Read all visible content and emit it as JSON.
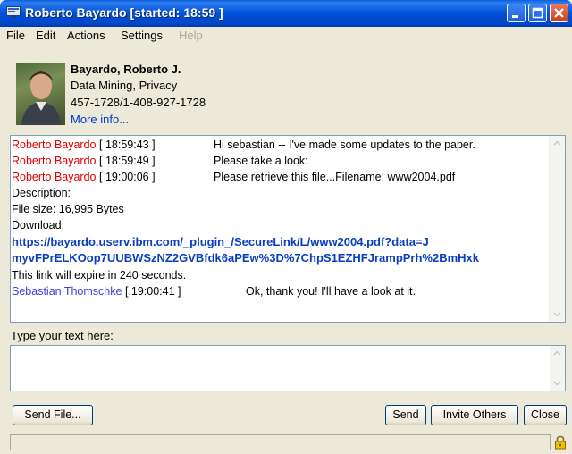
{
  "window": {
    "title": "Roberto Bayardo [started: 18:59 ]"
  },
  "menu": [
    {
      "label": "File",
      "enabled": true
    },
    {
      "label": "Edit",
      "enabled": true
    },
    {
      "label": "Actions",
      "enabled": true
    },
    {
      "label": "Settings",
      "enabled": true
    },
    {
      "label": "Help",
      "enabled": false
    }
  ],
  "profile": {
    "name": "Bayardo, Roberto J.",
    "department": "Data Mining, Privacy",
    "phone": "457-1728/1-408-927-1728",
    "more_info": "More info..."
  },
  "transcript": {
    "messages": [
      {
        "sender": "Roberto Bayardo",
        "time": "[ 18:59:43 ]",
        "text": "Hi sebastian -- I've made some updates to the paper."
      },
      {
        "sender": "Roberto Bayardo",
        "time": "[ 18:59:49 ]",
        "text": "Please take a look:"
      },
      {
        "sender": "Roberto Bayardo",
        "time": "[ 19:00:06 ]",
        "text": "Please retrieve this file...Filename: www2004.pdf"
      }
    ],
    "file_info": {
      "description": "Description:",
      "file_size": "File size: 16,995 Bytes",
      "download": "Download:",
      "link_line1": "https://bayardo.userv.ibm.com/_plugin_/SecureLink/L/www2004.pdf?data=J",
      "link_line2": "myvFPrELKOop7UUBWSzNZ2GVBfdk6aPEw%3D%7ChpS1EZHFJrampPrh%2BmHxk",
      "expire": "This link will expire in 240 seconds."
    },
    "reply": {
      "sender": "Sebastian Thomschke",
      "time": "[ 19:00:41 ]",
      "text": "Ok, thank you! I'll have a look at it."
    }
  },
  "composer": {
    "label": "Type your text here:",
    "value": ""
  },
  "buttons": {
    "send_file": "Send File...",
    "send": "Send",
    "invite_others": "Invite Others",
    "close": "Close"
  },
  "colors": {
    "remote_sender": "#e00000",
    "local_sender": "#3d3ddd",
    "link": "#0a3ec0"
  }
}
